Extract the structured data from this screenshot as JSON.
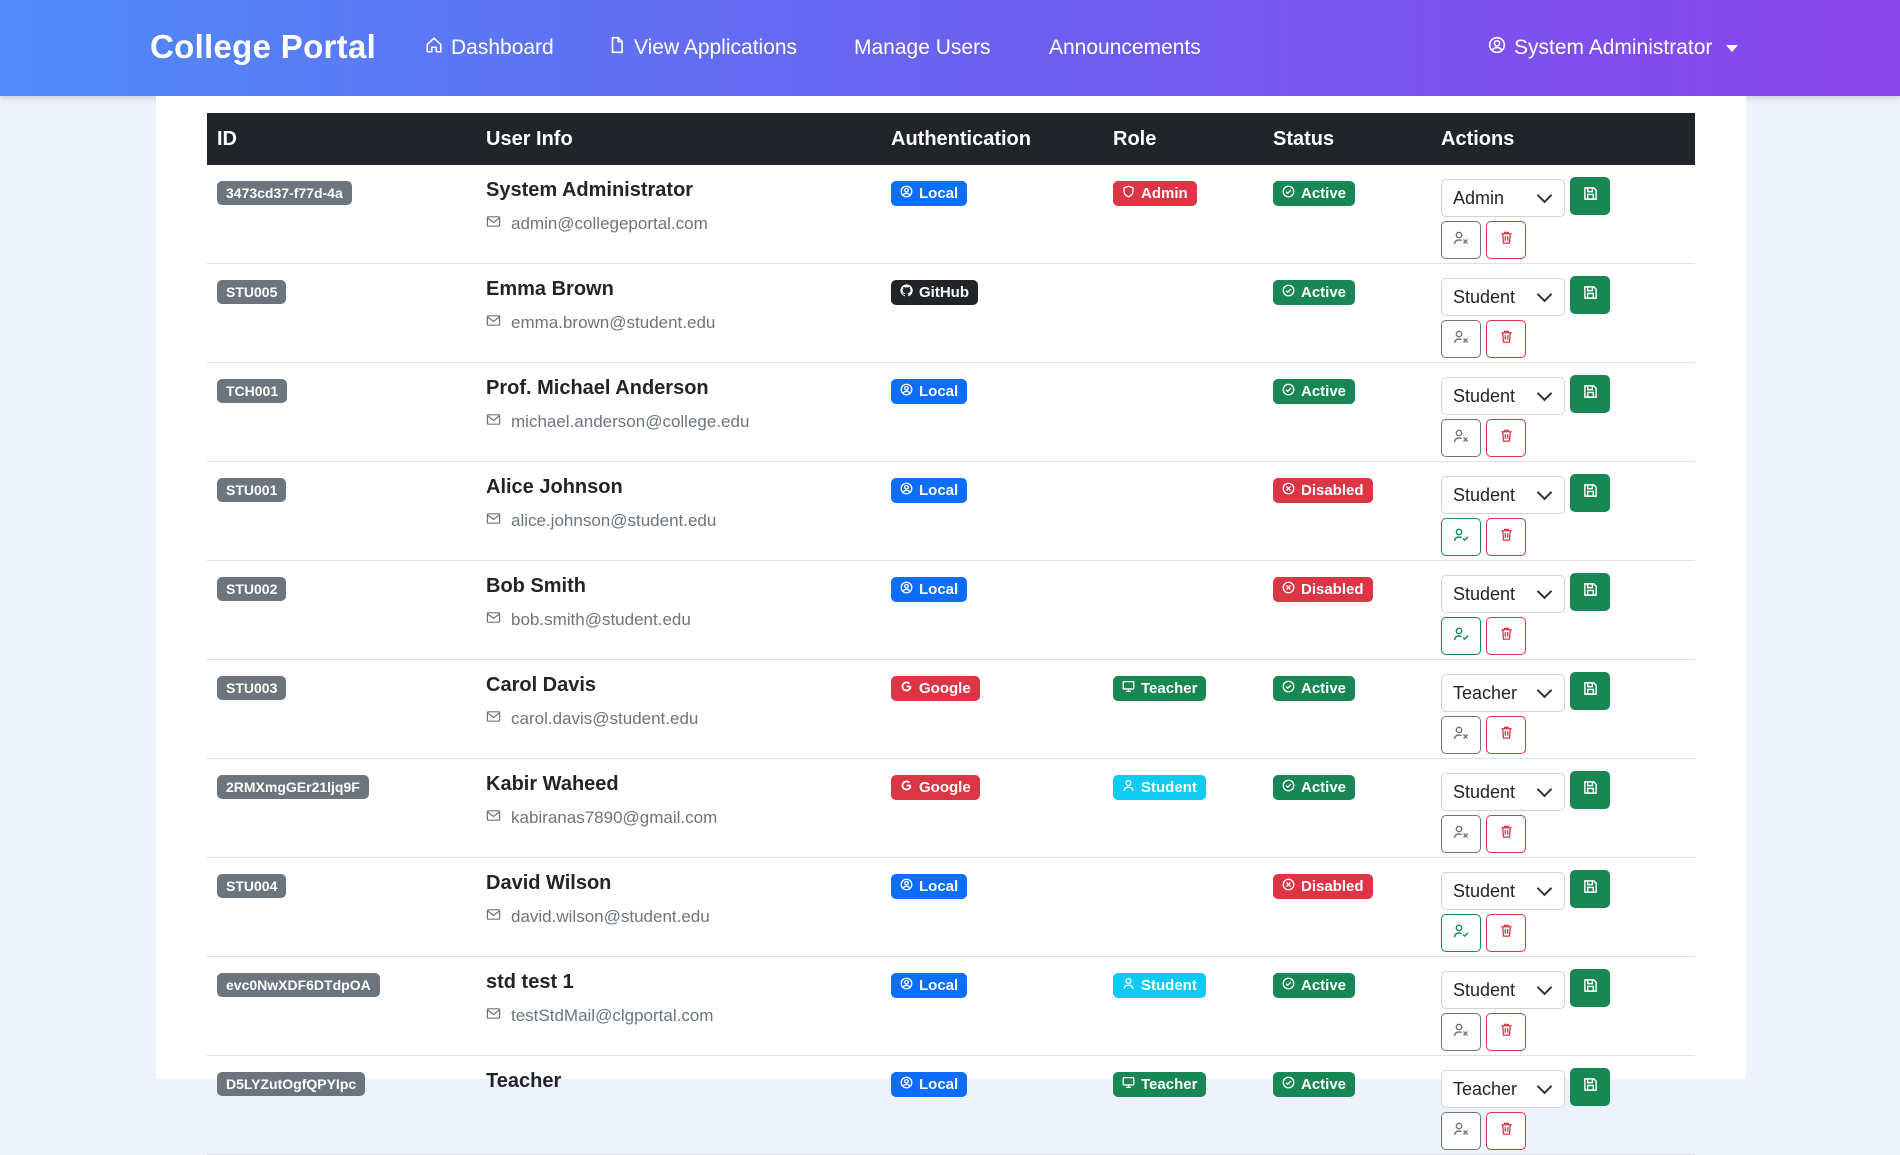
{
  "navbar": {
    "brand": "College Portal",
    "links": [
      {
        "label": "Dashboard",
        "icon": "house-icon"
      },
      {
        "label": "View Applications",
        "icon": "file-icon"
      },
      {
        "label": "Manage Users",
        "icon": ""
      },
      {
        "label": "Announcements",
        "icon": ""
      }
    ],
    "user": "System Administrator"
  },
  "table": {
    "headers": [
      "ID",
      "User Info",
      "Authentication",
      "Role",
      "Status",
      "Actions"
    ],
    "rows": [
      {
        "id": "3473cd37-f77d-4a",
        "name": "System Administrator",
        "email": "admin@collegeportal.com",
        "auth": "Local",
        "role": "Admin",
        "status": "Active",
        "select": "Admin",
        "toggle": "disable"
      },
      {
        "id": "STU005",
        "name": "Emma Brown",
        "email": "emma.brown@student.edu",
        "auth": "GitHub",
        "role": "",
        "status": "Active",
        "select": "Student",
        "toggle": "disable"
      },
      {
        "id": "TCH001",
        "name": "Prof. Michael Anderson",
        "email": "michael.anderson@college.edu",
        "auth": "Local",
        "role": "",
        "status": "Active",
        "select": "Student",
        "toggle": "disable"
      },
      {
        "id": "STU001",
        "name": "Alice Johnson",
        "email": "alice.johnson@student.edu",
        "auth": "Local",
        "role": "",
        "status": "Disabled",
        "select": "Student",
        "toggle": "enable"
      },
      {
        "id": "STU002",
        "name": "Bob Smith",
        "email": "bob.smith@student.edu",
        "auth": "Local",
        "role": "",
        "status": "Disabled",
        "select": "Student",
        "toggle": "enable"
      },
      {
        "id": "STU003",
        "name": "Carol Davis",
        "email": "carol.davis@student.edu",
        "auth": "Google",
        "role": "Teacher",
        "status": "Active",
        "select": "Teacher",
        "toggle": "disable"
      },
      {
        "id": "2RMXmgGEr21ljq9F",
        "name": "Kabir Waheed",
        "email": "kabiranas7890@gmail.com",
        "auth": "Google",
        "role": "Student",
        "status": "Active",
        "select": "Student",
        "toggle": "disable"
      },
      {
        "id": "STU004",
        "name": "David Wilson",
        "email": "david.wilson@student.edu",
        "auth": "Local",
        "role": "",
        "status": "Disabled",
        "select": "Student",
        "toggle": "enable"
      },
      {
        "id": "evc0NwXDF6DTdpOA",
        "name": "std test 1",
        "email": "testStdMail@clgportal.com",
        "auth": "Local",
        "role": "Student",
        "status": "Active",
        "select": "Student",
        "toggle": "disable"
      },
      {
        "id": "D5LYZutOgfQPYIpc",
        "name": "Teacher",
        "email": "",
        "auth": "Local",
        "role": "Teacher",
        "status": "Active",
        "select": "Teacher",
        "toggle": "disable"
      }
    ]
  },
  "colors": {
    "primary": "#0d6efd",
    "success": "#198754",
    "danger": "#dc3545",
    "info": "#0dcaf0",
    "dark": "#212529",
    "secondary": "#6c757d"
  }
}
